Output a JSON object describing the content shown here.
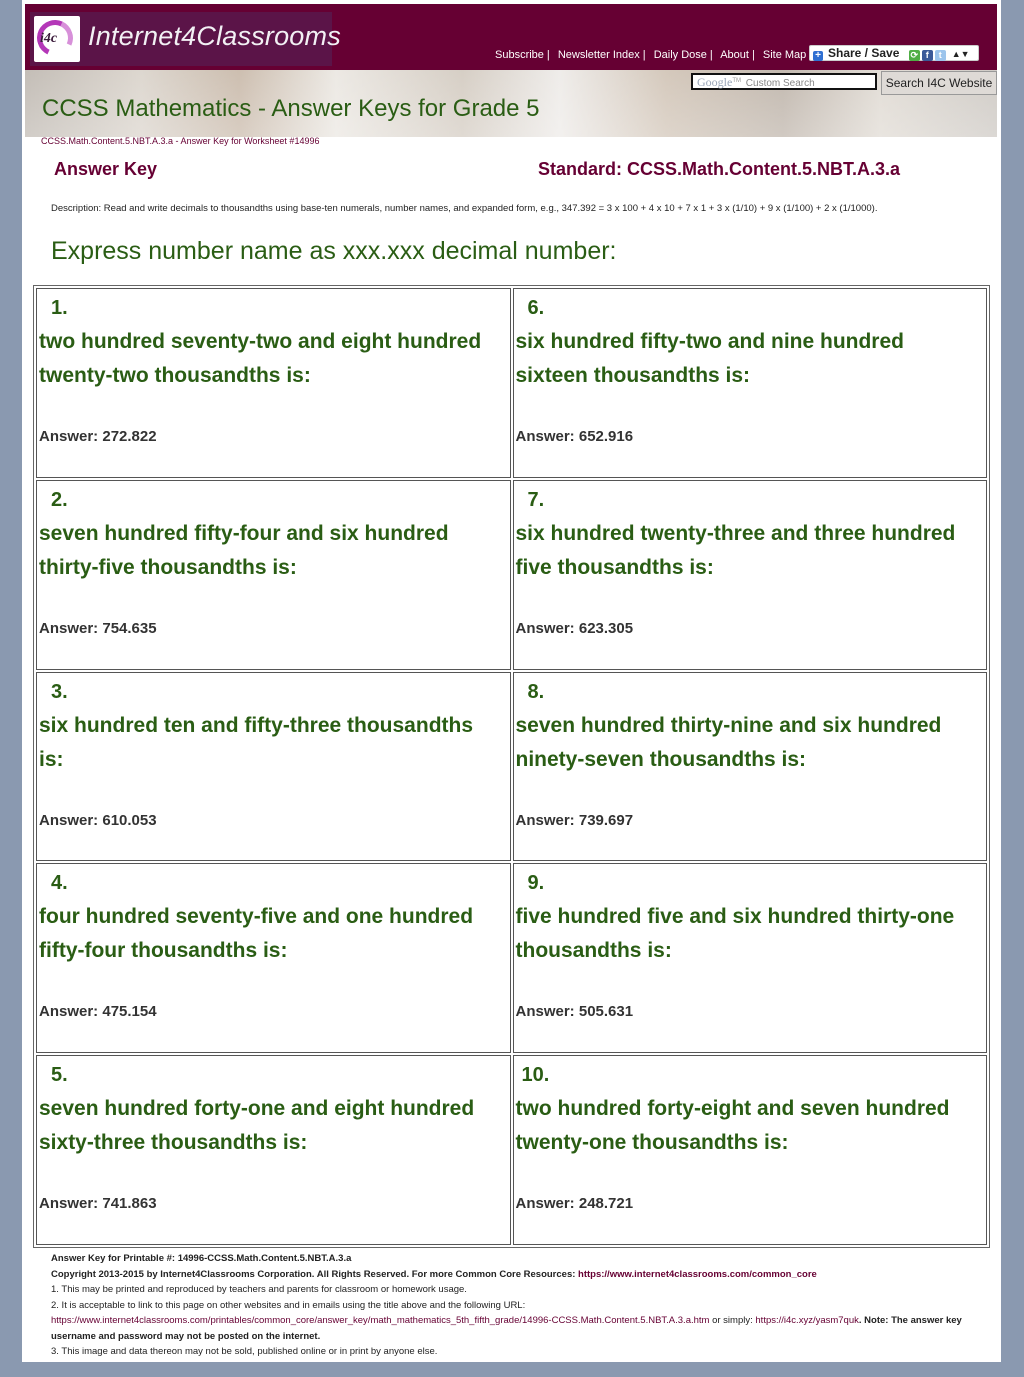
{
  "header": {
    "logo_mark": "i4c",
    "logo_text": "Internet4Classrooms",
    "nav": [
      {
        "label": "Subscribe"
      },
      {
        "label": "Newsletter Index"
      },
      {
        "label": "Daily Dose"
      },
      {
        "label": "About"
      },
      {
        "label": "Site Map"
      }
    ],
    "nav_separator": "|",
    "share_label": "Share / Save",
    "share_icons": [
      "addtoany-icon",
      "facebook-icon",
      "twitter-icon"
    ],
    "search": {
      "placeholder_brand": "Google",
      "placeholder_text": "Custom Search",
      "button_label": "Search I4C Website"
    },
    "title": "CCSS Mathematics - Answer Keys for Grade 5"
  },
  "breadcrumb": "CCSS.Math.Content.5.NBT.A.3.a - Answer Key for Worksheet #14996",
  "answer_key_title": "Answer Key",
  "standard": "Standard: CCSS.Math.Content.5.NBT.A.3.a",
  "description": "Description: Read and write decimals to thousandths using base-ten numerals, number names, and expanded form, e.g., 347.392 = 3 x 100 + 4 x 10 + 7 x 1 + 3 x (1/10) + 9 x (1/100) + 2 x (1/1000).",
  "instructions": "Express number name as xxx.xxx decimal number:",
  "problems": [
    {
      "number": "1.",
      "question": "two hundred seventy-two and eight hundred twenty-two thousandths is:",
      "answer": "Answer: 272.822"
    },
    {
      "number": "6.",
      "question": "six hundred fifty-two and nine hundred sixteen thousandths is:",
      "answer": "Answer: 652.916"
    },
    {
      "number": "2.",
      "question": "seven hundred fifty-four and six hundred thirty-five thousandths is:",
      "answer": "Answer: 754.635"
    },
    {
      "number": "7.",
      "question": "six hundred twenty-three and three hundred five thousandths is:",
      "answer": "Answer: 623.305"
    },
    {
      "number": "3.",
      "question": "six hundred ten and fifty-three thousandths is:",
      "answer": "Answer: 610.053"
    },
    {
      "number": "8.",
      "question": "seven hundred thirty-nine and six hundred ninety-seven thousandths is:",
      "answer": "Answer: 739.697"
    },
    {
      "number": "4.",
      "question": "four hundred seventy-five and one hundred fifty-four thousandths is:",
      "answer": "Answer: 475.154"
    },
    {
      "number": "9.",
      "question": "five hundred five and six hundred thirty-one thousandths is:",
      "answer": "Answer: 505.631"
    },
    {
      "number": "5.",
      "question": "seven hundred forty-one and eight hundred sixty-three thousandths is:",
      "answer": "Answer: 741.863"
    },
    {
      "number": "10.",
      "question": "two hundred forty-eight and seven hundred twenty-one thousandths is:",
      "answer": "Answer: 248.721"
    }
  ],
  "footer": {
    "printable": "Answer Key for Printable #: 14996-CCSS.Math.Content.5.NBT.A.3.a",
    "copyright": "Copyright 2013-2015 by Internet4Classrooms Corporation. All Rights Reserved. For more Common Core Resources:",
    "copyright_link": "https://www.internet4classrooms.com/common_core",
    "note1": "1. This may be printed and reproduced by teachers and parents for classroom or homework usage.",
    "note2": "2. It is acceptable to link to this page on other websites and in emails using the title above and the following URL:",
    "url_long": "https://www.internet4classrooms.com/printables/common_core/answer_key/math_mathematics_5th_fifth_grade/14996-CCSS.Math.Content.5.NBT.A.3.a.htm",
    "or_simply": " or simply: ",
    "url_short": "https://i4c.xyz/yasm7quk",
    "note_warning": ". Note: The answer key username and password may not be posted on the internet.",
    "note3": "3. This image and data thereon may not be sold, published online or in print by anyone else."
  }
}
